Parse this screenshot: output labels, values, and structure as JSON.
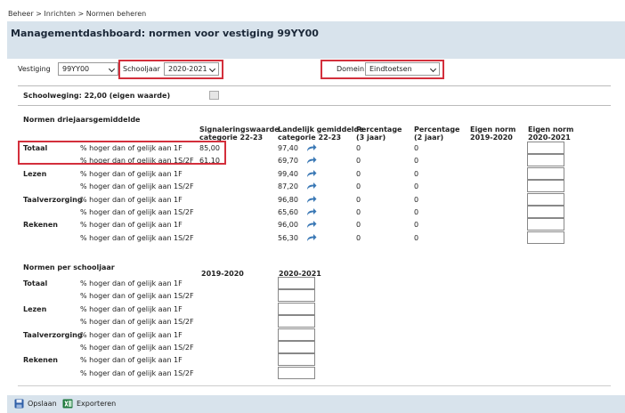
{
  "breadcrumb": "Beheer > Inrichten > Normen beheren",
  "title": "Managementdashboard: normen voor vestiging 99YY00",
  "filters": {
    "vestiging_label": "Vestiging",
    "vestiging_value": "99YY00",
    "schooljaar_label": "Schooljaar",
    "schooljaar_value": "2020-2021",
    "domein_label": "Domein",
    "domein_value": "Eindtoetsen"
  },
  "schoolweging": "Schoolweging: 22,00 (eigen waarde)",
  "section1": {
    "title": "Normen driejaarsgemiddelde",
    "headers": {
      "signalering": [
        "Signaleringswaarde",
        "categorie 22-23"
      ],
      "landelijk": [
        "Landelijk gemiddelde",
        "categorie 22-23"
      ],
      "perc3": [
        "Percentage",
        "(3 jaar)"
      ],
      "perc2": [
        "Percentage",
        "(2 jaar)"
      ],
      "eigen1": [
        "Eigen norm",
        "2019-2020"
      ],
      "eigen2": [
        "Eigen norm",
        "2020-2021"
      ]
    },
    "rows": [
      {
        "subject": "Totaal",
        "desc": "% hoger dan of gelijk aan 1F",
        "signal": "85,00",
        "landelijk": "97,40",
        "p3": "0",
        "p2": "0"
      },
      {
        "subject": "",
        "desc": "% hoger dan of gelijk aan 1S/2F",
        "signal": "61,10",
        "landelijk": "69,70",
        "p3": "0",
        "p2": "0"
      },
      {
        "subject": "Lezen",
        "desc": "% hoger dan of gelijk aan 1F",
        "signal": "",
        "landelijk": "99,40",
        "p3": "0",
        "p2": "0"
      },
      {
        "subject": "",
        "desc": "% hoger dan of gelijk aan 1S/2F",
        "signal": "",
        "landelijk": "87,20",
        "p3": "0",
        "p2": "0"
      },
      {
        "subject": "Taalverzorging",
        "desc": "% hoger dan of gelijk aan 1F",
        "signal": "",
        "landelijk": "96,80",
        "p3": "0",
        "p2": "0"
      },
      {
        "subject": "",
        "desc": "% hoger dan of gelijk aan 1S/2F",
        "signal": "",
        "landelijk": "65,60",
        "p3": "0",
        "p2": "0"
      },
      {
        "subject": "Rekenen",
        "desc": "% hoger dan of gelijk aan 1F",
        "signal": "",
        "landelijk": "96,00",
        "p3": "0",
        "p2": "0"
      },
      {
        "subject": "",
        "desc": "% hoger dan of gelijk aan 1S/2F",
        "signal": "",
        "landelijk": "56,30",
        "p3": "0",
        "p2": "0"
      }
    ]
  },
  "section2": {
    "title": "Normen per schooljaar",
    "col1": "2019-2020",
    "col2": "2020-2021",
    "rows": [
      {
        "subject": "Totaal",
        "desc": "% hoger dan of gelijk aan 1F"
      },
      {
        "subject": "",
        "desc": "% hoger dan of gelijk aan 1S/2F"
      },
      {
        "subject": "Lezen",
        "desc": "% hoger dan of gelijk aan 1F"
      },
      {
        "subject": "",
        "desc": "% hoger dan of gelijk aan 1S/2F"
      },
      {
        "subject": "Taalverzorging",
        "desc": "% hoger dan of gelijk aan 1F"
      },
      {
        "subject": "",
        "desc": "% hoger dan of gelijk aan 1S/2F"
      },
      {
        "subject": "Rekenen",
        "desc": "% hoger dan of gelijk aan 1F"
      },
      {
        "subject": "",
        "desc": "% hoger dan of gelijk aan 1S/2F"
      }
    ]
  },
  "footer": {
    "save_label": "Opslaan",
    "export_label": "Exporteren"
  },
  "colors": {
    "header_bg": "#d8e3ec",
    "highlight": "#d32f3c",
    "arrow": "#3a78b5"
  }
}
